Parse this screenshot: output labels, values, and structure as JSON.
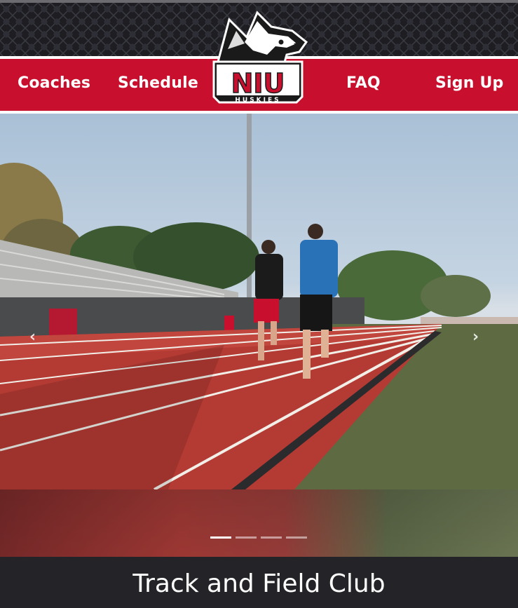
{
  "nav": {
    "coaches": "Coaches",
    "schedule": "Schedule",
    "faq": "FAQ",
    "signup": "Sign Up"
  },
  "logo": {
    "text": "NIU",
    "subtext": "HUSKIES",
    "icon": "husky-head-logo"
  },
  "carousel": {
    "prev_icon": "chevron-left-icon",
    "next_icon": "chevron-right-icon",
    "slides": 4,
    "active_slide": 1
  },
  "footer": {
    "title": "Track and Field Club"
  },
  "colors": {
    "brand_red": "#c8102e",
    "dark": "#242428",
    "white": "#ffffff"
  }
}
